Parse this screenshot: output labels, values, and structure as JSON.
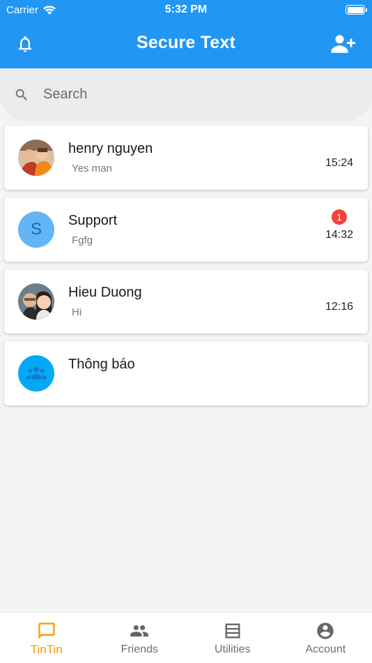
{
  "status_bar": {
    "carrier": "Carrier",
    "time": "5:32 PM"
  },
  "app_bar": {
    "title": "Secure Text",
    "left_icon": "bell-icon",
    "right_icon": "add-user-icon"
  },
  "search": {
    "placeholder": "Search",
    "value": ""
  },
  "chats": [
    {
      "name": "henry nguyen",
      "preview": "Yes man",
      "time": "15:24",
      "unread": "",
      "avatar": "photo"
    },
    {
      "name": "Support",
      "preview": "Fgfg",
      "time": "14:32",
      "unread": "1",
      "avatar_letter": "S"
    },
    {
      "name": "Hieu Duong",
      "preview": "Hi",
      "time": "12:16",
      "unread": "",
      "avatar": "photo"
    },
    {
      "name": "Thông báo",
      "preview": "",
      "time": "",
      "unread": "",
      "avatar": "group-icon"
    }
  ],
  "bottom_nav": [
    {
      "label": "TinTin",
      "icon": "chat-icon",
      "active": true
    },
    {
      "label": "Friends",
      "icon": "people-icon",
      "active": false
    },
    {
      "label": "Utilities",
      "icon": "list-icon",
      "active": false
    },
    {
      "label": "Account",
      "icon": "account-circle-icon",
      "active": false
    }
  ],
  "colors": {
    "primary": "#2196f3",
    "active_tab": "#ff9800",
    "badge": "#f44336",
    "support_avatar": "#64b5f6",
    "group_avatar": "#03a9f4"
  }
}
